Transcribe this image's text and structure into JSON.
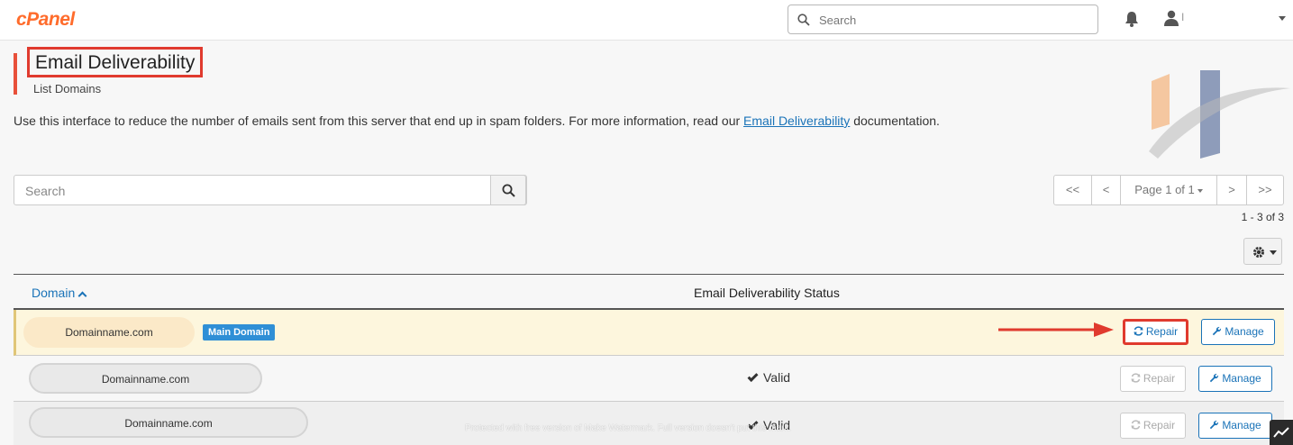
{
  "header": {
    "logo": "cPanel",
    "search_placeholder": "Search",
    "user_label": "I"
  },
  "page": {
    "title": "Email Deliverability",
    "subtitle": "List Domains",
    "intro_text": "Use this interface to reduce the number of emails sent from this server that end up in spam folders. For more information, read our ",
    "intro_link": "Email Deliverability",
    "intro_suffix": " documentation."
  },
  "list": {
    "search_placeholder": "Search",
    "pager": {
      "first": "<<",
      "prev": "<",
      "page_label": "Page 1 of 1",
      "next": ">",
      "last": ">>"
    },
    "count": "1 - 3 of 3"
  },
  "table": {
    "col_domain": "Domain",
    "col_status": "Email Deliverability Status",
    "rows": [
      {
        "domain": "Domainname.com",
        "badge": "Main Domain",
        "status": "",
        "repair": "Repair",
        "manage": "Manage"
      },
      {
        "domain": "Domainname.com",
        "status": "Valid",
        "repair": "Repair",
        "manage": "Manage"
      },
      {
        "domain": "Domainname.com",
        "status": "Valid",
        "repair": "Repair",
        "manage": "Manage"
      }
    ]
  },
  "watermark": "Protected with free version of Make Watermark. Full version doesn't put this mark.",
  "colors": {
    "accent": "#1a73b8",
    "brand": "#ff6c2c",
    "annotation": "#e03a2e",
    "highlight_row": "#fdf6dd"
  }
}
